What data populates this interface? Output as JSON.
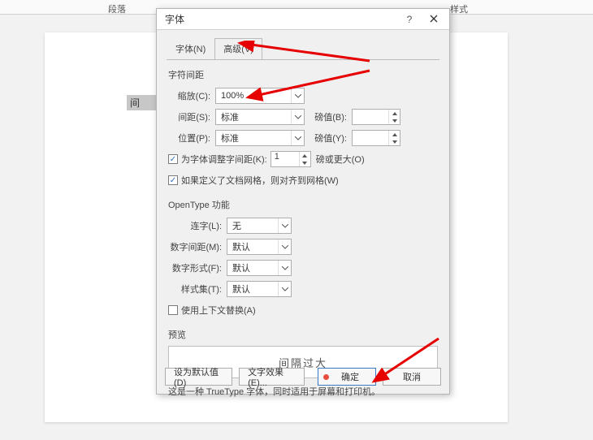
{
  "ribbon": {
    "paragraph": "段落",
    "styles": "样式"
  },
  "doc": {
    "selected_text": "间 隔"
  },
  "dialog": {
    "title": "字体",
    "help": "?",
    "tabs": {
      "font": "字体(N)",
      "advanced": "高级(V)"
    },
    "char_spacing": {
      "title": "字符间距",
      "scale_label": "缩放(C):",
      "scale_value": "100%",
      "spacing_label": "间距(S):",
      "spacing_value": "标准",
      "pound_label_b": "磅值(B):",
      "position_label": "位置(P):",
      "position_value": "标准",
      "pound_label_y": "磅值(Y):",
      "kerning_check": "为字体调整字间距(K):",
      "kerning_value": "1",
      "kerning_unit": "磅或更大(O)",
      "grid_check": "如果定义了文档网格，则对齐到网格(W)"
    },
    "opentype": {
      "title": "OpenType 功能",
      "ligatures_label": "连字(L):",
      "ligatures_value": "无",
      "num_spacing_label": "数字间距(M):",
      "num_spacing_value": "默认",
      "num_form_label": "数字形式(F):",
      "num_form_value": "默认",
      "style_set_label": "样式集(T):",
      "style_set_value": "默认",
      "context_check": "使用上下文替换(A)"
    },
    "preview": {
      "title": "预览",
      "text": "间隔过大"
    },
    "desc": "这是一种 TrueType 字体，同时适用于屏幕和打印机。",
    "buttons": {
      "set_default": "设为默认值(D)",
      "text_effects": "文字效果(E)...",
      "ok": "确定",
      "cancel": "取消"
    }
  }
}
